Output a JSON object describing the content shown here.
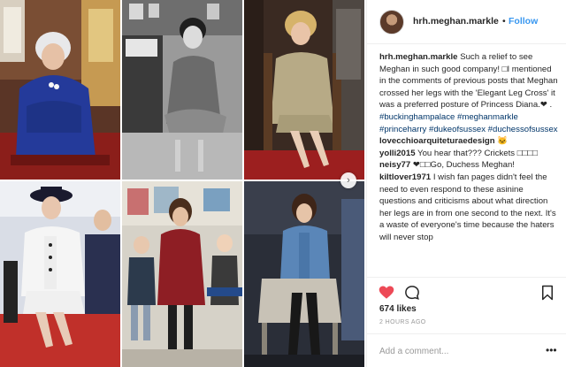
{
  "post": {
    "username": "hrh.meghan.markle",
    "separator": "•",
    "follow_label": "Follow",
    "caption": {
      "username": "hrh.meghan.markle",
      "text": "Such a relief to see Meghan in such good company! □I mentioned in the comments of previous posts that Meghan crossed her legs with the 'Elegant Leg Cross' it was a preferred posture of Princess Diana.❤ ."
    },
    "hashtags": [
      "#buckinghampalace",
      "#meghanmarkle",
      "#princeharry",
      "#dukeofsussex",
      "#duchessofsussex"
    ],
    "comments": [
      {
        "user": "lovecchioarquiteturaedesign",
        "text": "🐱"
      },
      {
        "user": "yolli2015",
        "text": "You hear that??? Crickets □□□□"
      },
      {
        "user": "neisy77",
        "text": "❤□□Go, Duchess Meghan!"
      },
      {
        "user": "kiltlover1971",
        "text": "I wish fan pages didn't feel the need to even respond to these asinine questions and criticisms about what direction her legs are in from one second to the next. It's a waste of everyone's time because the haters will never stop"
      }
    ],
    "likes": "674 likes",
    "timestamp": "2 HOURS AGO",
    "add_comment_placeholder": "Add a comment...",
    "more_options": "•••",
    "carousel_next": "›"
  },
  "icons": {
    "like": "heart-icon",
    "comment": "speech-bubble-icon",
    "save": "bookmark-icon",
    "next": "chevron-right-icon"
  },
  "colors": {
    "like": "#ed4956",
    "follow": "#3897f0",
    "hashtag": "#003569",
    "muted": "#999999",
    "border": "#efefef"
  }
}
